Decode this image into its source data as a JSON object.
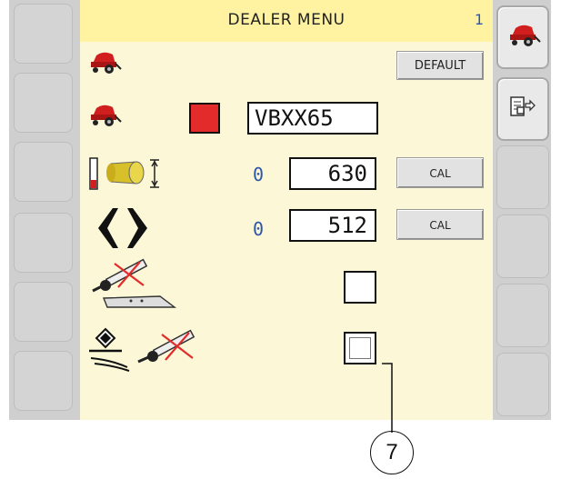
{
  "header": {
    "title": "DEALER MENU",
    "page_number": "1"
  },
  "rows": [
    {
      "icon": "baler-icon",
      "button_label": "DEFAULT"
    },
    {
      "icon": "baler-icon",
      "color": "#e32b2b",
      "model_value": "VBXX65"
    },
    {
      "icon": "bale-diameter-icon",
      "indicator": "0",
      "value": "630",
      "button_label": "CAL"
    },
    {
      "icon": "bale-chamber-arrows-icon",
      "indicator": "0",
      "value": "512",
      "button_label": "CAL"
    },
    {
      "icon": "knife-disabled-icon",
      "checked": false
    },
    {
      "icon": "pickup-disabled-icon",
      "checked": false
    }
  ],
  "right_softkeys": [
    {
      "icon": "baler-icon",
      "active": true
    },
    {
      "icon": "exit-page-icon",
      "active": true
    }
  ],
  "callout": {
    "label": "7"
  }
}
